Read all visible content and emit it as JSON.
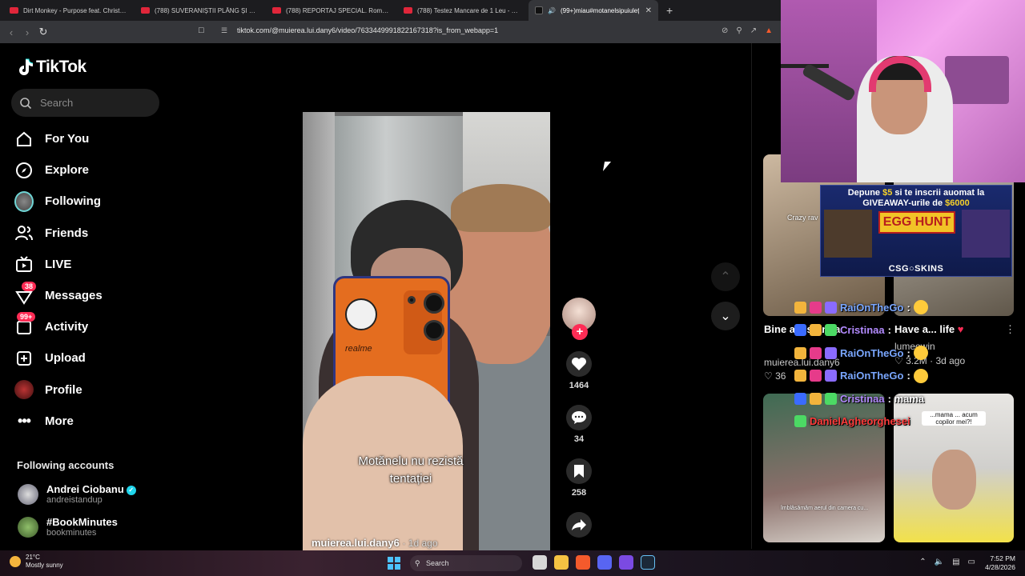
{
  "browser": {
    "tabs": [
      {
        "title": "Dirt Monkey - Purpose feat. Christian",
        "kind": "youtube"
      },
      {
        "title": "(788) SUVERANIȘTII PLÂNG ȘI STRES",
        "kind": "youtube"
      },
      {
        "title": "(788) REPORTAJ SPECIAL. Românii ca",
        "kind": "youtube"
      },
      {
        "title": "(788) Testez Mancare de 1 Leu - YouT",
        "kind": "youtube"
      },
      {
        "title": "(99+)miau#motanelsipuiuleț",
        "kind": "tiktok",
        "active": true
      }
    ],
    "url": "tiktok.com/@muierea.lui.dany6/video/7633449991822167318?is_from_webapp=1"
  },
  "tiktok": {
    "logo": "TikTok",
    "search_placeholder": "Search",
    "nav": [
      {
        "label": "For You",
        "icon": "home-icon"
      },
      {
        "label": "Explore",
        "icon": "compass-icon"
      },
      {
        "label": "Following",
        "icon": "following-avatar-icon"
      },
      {
        "label": "Friends",
        "icon": "friends-icon"
      },
      {
        "label": "LIVE",
        "icon": "live-tv-icon"
      },
      {
        "label": "Messages",
        "icon": "messages-icon",
        "badge": "38"
      },
      {
        "label": "Activity",
        "icon": "activity-icon",
        "badge": "99+"
      },
      {
        "label": "Upload",
        "icon": "upload-icon"
      },
      {
        "label": "Profile",
        "icon": "profile-avatar-icon"
      },
      {
        "label": "More",
        "icon": "more-icon"
      }
    ],
    "following_title": "Following accounts",
    "following_accounts": [
      {
        "name": "Andrei Ciobanu",
        "handle": "andreistandup",
        "verified": true
      },
      {
        "name": "#BookMinutes",
        "handle": "bookminutes",
        "verified": false
      }
    ],
    "video": {
      "caption_line1": "Motănelu nu rezistă",
      "caption_line2": "tentației",
      "author": "muierea.lui.dany6",
      "age": "1d ago",
      "phone_brand": "realme",
      "likes": "1464",
      "comments": "34",
      "saves": "258"
    },
    "related": [
      {
        "title": "Bine a... stânga",
        "user": "muierea.lui.dany6",
        "likes": "36"
      },
      {
        "title": "Have a... life",
        "user": "lumeowin",
        "views": "3.2M",
        "age": "3d ago"
      }
    ],
    "thumb_texts": [
      "Crazy rav",
      "...mama ... acum copilor mei?!",
      "îmblâsămâm aerul din camera cu..."
    ]
  },
  "stream": {
    "ad": {
      "line1_pre": "Depune",
      "line1_amount": "$5",
      "line1_post": "si te inscrii auomat la",
      "line2_pre": "GIVEAWAY-urile de",
      "line2_amount": "$6000",
      "headline": "EGG HUNT",
      "brand": "CSG○SKINS"
    },
    "chat": [
      {
        "name": "RaiOnTheGo",
        "msg": ":",
        "color": "blue",
        "laugh": true
      },
      {
        "name": "Cristinaa",
        "msg": ":",
        "color": "purple"
      },
      {
        "name": "RaiOnTheGo",
        "msg": ":",
        "color": "blue",
        "laugh": true
      },
      {
        "name": "RaiOnTheGo",
        "msg": ":",
        "color": "blue",
        "laugh": true
      },
      {
        "name": "Cristinaa",
        "msg": ": mama",
        "color": "purple"
      },
      {
        "name": "DanielAgheorghesei",
        "msg": "",
        "color": "red"
      }
    ]
  },
  "taskbar": {
    "temp": "21°C",
    "weather": "Mostly sunny",
    "search": "Search",
    "time": "7:52 PM",
    "date": "4/28/2026"
  },
  "colors": {
    "accent": "#fe2c55",
    "verified": "#20d5ec",
    "ad_yellow": "#f7d229"
  }
}
